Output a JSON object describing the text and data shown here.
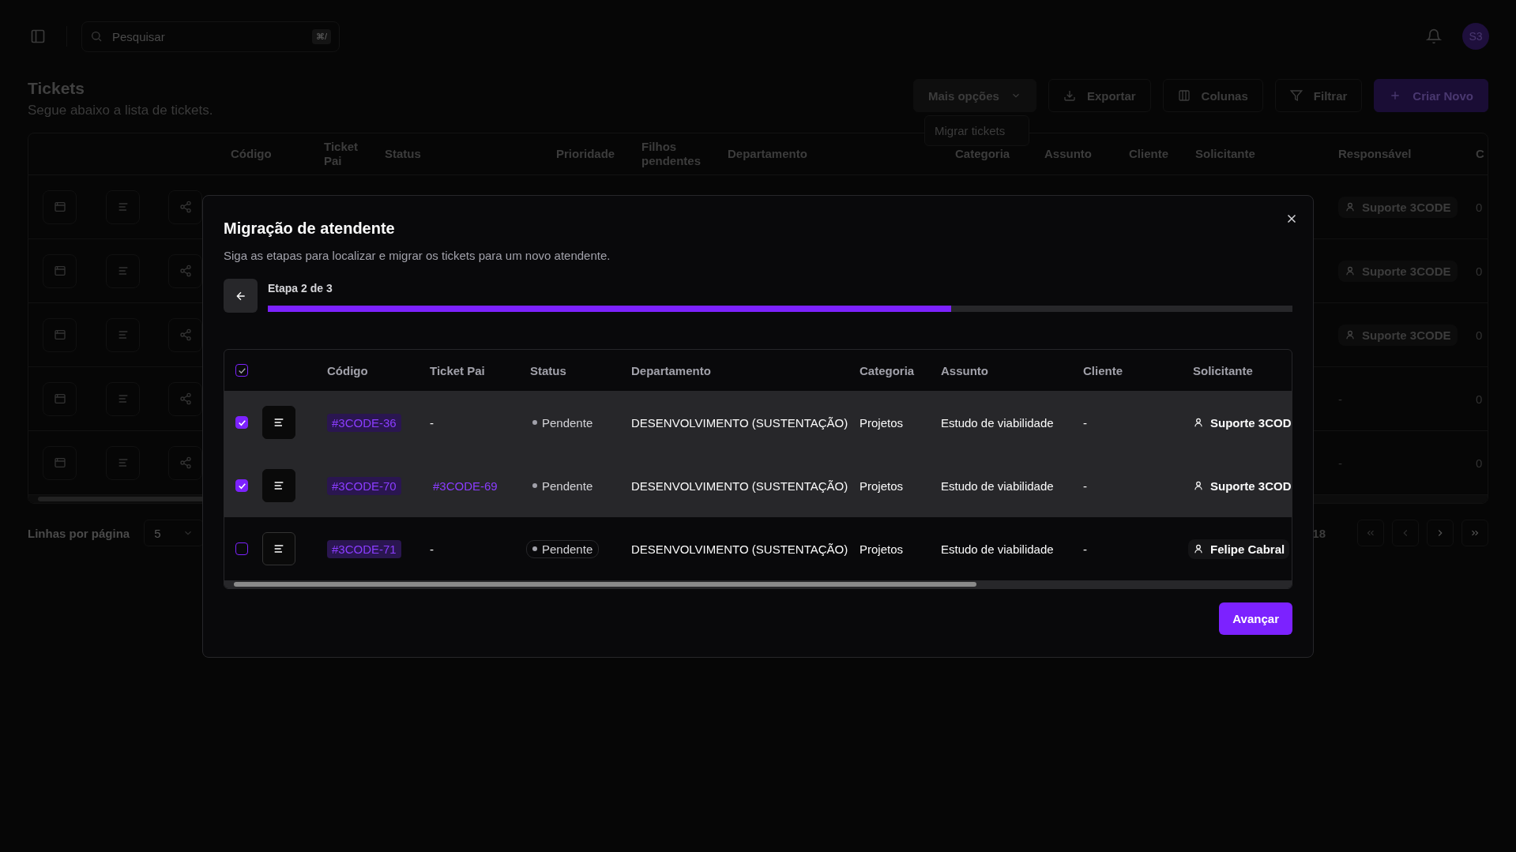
{
  "topbar": {
    "search_placeholder": "Pesquisar",
    "search_shortcut": "⌘/",
    "avatar": "S3"
  },
  "header": {
    "title": "Tickets",
    "subtitle": "Segue abaixo a lista de tickets."
  },
  "actions": [
    {
      "label": "Mais opções",
      "kind": "menu"
    },
    {
      "label": "Exportar",
      "kind": "export"
    },
    {
      "label": "Colunas",
      "kind": "columns"
    },
    {
      "label": "Filtrar",
      "kind": "filter"
    },
    {
      "label": "Criar Novo",
      "kind": "create"
    }
  ],
  "dropdown": {
    "items": [
      "Migrar tickets"
    ]
  },
  "table": {
    "columns": [
      "Código",
      "Ticket Pai",
      "Status",
      "Prioridade",
      "Filhos pendentes",
      "Departamento",
      "Categoria",
      "Assunto",
      "Cliente",
      "Solicitante",
      "Responsável",
      "C"
    ],
    "rows": [
      {
        "responsavel": "Suporte 3CODE",
        "column_12": "0"
      },
      {
        "responsavel": "Suporte 3CODE",
        "column_12": "0"
      },
      {
        "responsavel": "Suporte 3CODE",
        "column_12": "0"
      },
      {
        "responsavel": "-",
        "column_12": "0"
      },
      {
        "responsavel": "-",
        "column_12": "0"
      }
    ]
  },
  "pagination": {
    "rows_label": "Linhas por página",
    "rows_per_page": "5",
    "page_total": "18"
  },
  "modal": {
    "title": "Migração de atendente",
    "subtitle": "Siga as etapas para localizar e migrar os tickets para um novo atendente.",
    "step": "Etapa 2 de 3",
    "level": 0.667,
    "all_selected": true,
    "columns": [
      "Código",
      "Ticket Pai",
      "Status",
      "Departamento",
      "Categoria",
      "Assunto",
      "Cliente",
      "Solicitante"
    ],
    "rows": [
      {
        "selected": true,
        "code": "#3CODE-36",
        "parent": "-",
        "parent_link": false,
        "status": "Pendente",
        "department": "DESENVOLVIMENTO (SUSTENTAÇÃO)",
        "category": "Projetos",
        "subject": "Estudo de viabilidade",
        "client": "-",
        "requester": "Suporte 3COD"
      },
      {
        "selected": true,
        "code": "#3CODE-70",
        "parent": "#3CODE-69",
        "parent_link": true,
        "status": "Pendente",
        "department": "DESENVOLVIMENTO (SUSTENTAÇÃO)",
        "category": "Projetos",
        "subject": "Estudo de viabilidade",
        "client": "-",
        "requester": "Suporte 3COD"
      },
      {
        "selected": false,
        "code": "#3CODE-71",
        "parent": "-",
        "parent_link": false,
        "status": "Pendente",
        "department": "DESENVOLVIMENTO (SUSTENTAÇÃO)",
        "category": "Projetos",
        "subject": "Estudo de viabilidade",
        "client": "-",
        "requester": "Felipe Cabral"
      }
    ],
    "next_button": "Avançar"
  }
}
